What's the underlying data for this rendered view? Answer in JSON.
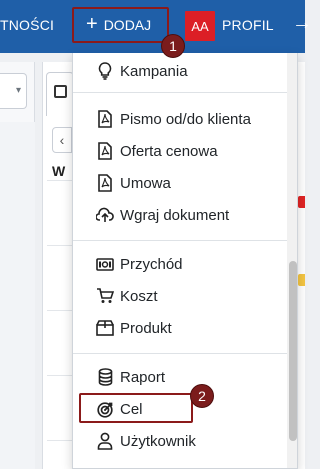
{
  "navbar": {
    "left_text": "TNOŚCI",
    "add_button": {
      "plus": "+",
      "label": "DODAJ"
    },
    "avatar_initials": "AA",
    "profile_label": "PROFIL",
    "logout_glyph": "→"
  },
  "badges": {
    "first": "1",
    "second": "2"
  },
  "background": {
    "week_header": "W",
    "prev_glyph": "‹",
    "select_glyph": "▾"
  },
  "menu": {
    "groups": [
      [
        {
          "label": "Kampania",
          "icon": "lightbulb-icon"
        }
      ],
      [
        {
          "label": "Pismo od/do klienta",
          "icon": "file-pdf-icon"
        },
        {
          "label": "Oferta cenowa",
          "icon": "file-pdf-icon"
        },
        {
          "label": "Umowa",
          "icon": "file-pdf-icon"
        },
        {
          "label": "Wgraj dokument",
          "icon": "cloud-upload-icon"
        }
      ],
      [
        {
          "label": "Przychód",
          "icon": "money-bill-icon"
        },
        {
          "label": "Koszt",
          "icon": "shopping-cart-icon"
        },
        {
          "label": "Produkt",
          "icon": "box-icon"
        }
      ],
      [
        {
          "label": "Raport",
          "icon": "database-icon"
        },
        {
          "label": "Cel",
          "icon": "target-icon"
        },
        {
          "label": "Użytkownik",
          "icon": "user-icon"
        }
      ]
    ]
  },
  "colors": {
    "navbar": "#1f5fa8",
    "highlight_border": "#8b1a1a",
    "badge": "#7b1c1c",
    "avatar": "#dc1f26"
  }
}
